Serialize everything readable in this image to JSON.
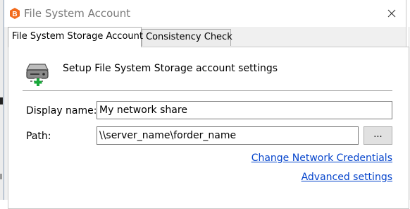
{
  "window": {
    "title": "File System Account",
    "close_label": "✕",
    "icon": "app-logo-b-icon",
    "icon_letter": "B",
    "brand_color": "#f26a1b"
  },
  "tabs": [
    {
      "label": "File System Storage Account",
      "active": true
    },
    {
      "label": "Consistency Check",
      "active": false
    }
  ],
  "panel": {
    "header_icon": "network-drive-add-icon",
    "header_text": "Setup File System Storage account settings"
  },
  "form": {
    "display_name_label": "Display name:",
    "display_name_value": "My network share",
    "path_label": "Path:",
    "path_value": "\\\\server_name\\forder_name",
    "browse_label": "..."
  },
  "links": {
    "change_credentials": "Change Network Credentials",
    "advanced_settings": "Advanced settings",
    "link_color": "#0645cc"
  }
}
